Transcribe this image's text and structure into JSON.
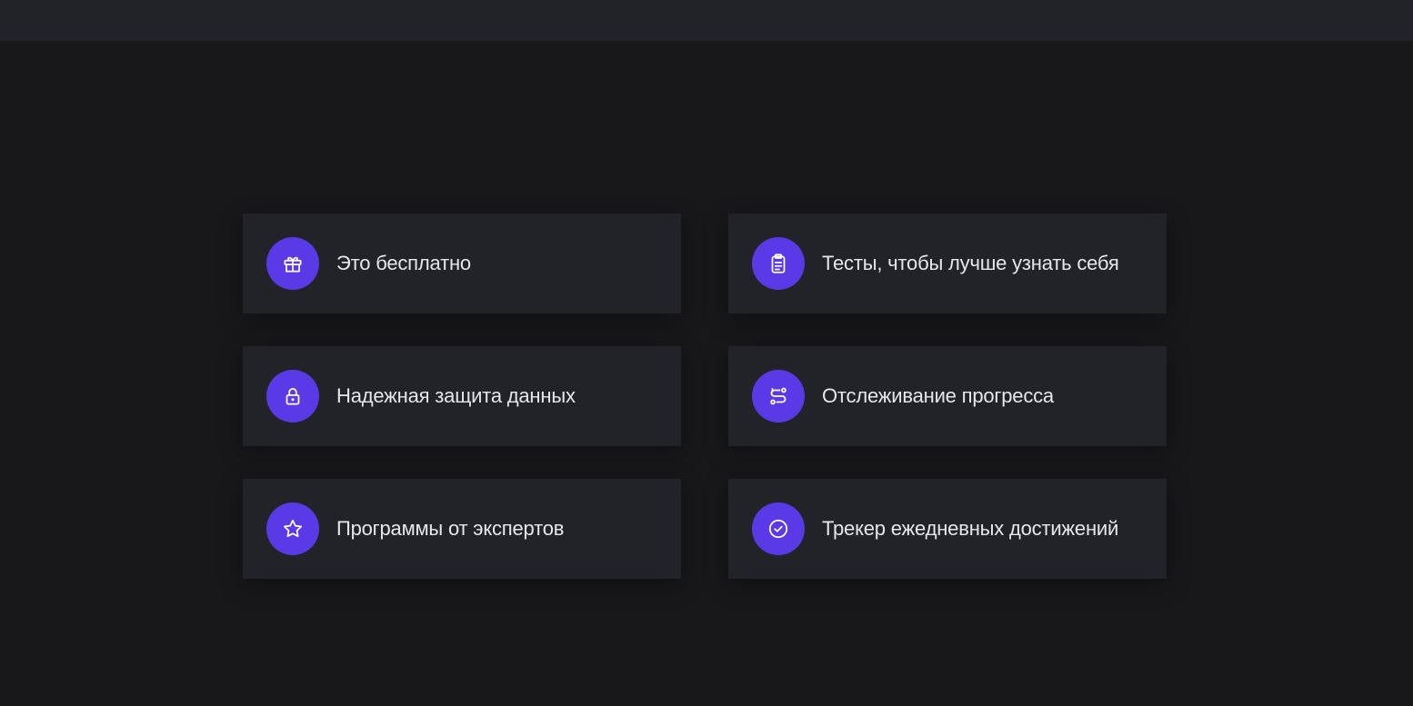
{
  "colors": {
    "background": "#18181a",
    "card": "#222328",
    "accent": "#5a3ae6",
    "text": "#e6e6ee"
  },
  "features": [
    {
      "label": "Это бесплатно",
      "icon": "gift-icon"
    },
    {
      "label": "Тесты, чтобы лучше узнать себя",
      "icon": "clipboard-icon"
    },
    {
      "label": "Надежная защита данных",
      "icon": "lock-icon"
    },
    {
      "label": "Отслеживание прогресса",
      "icon": "route-icon"
    },
    {
      "label": "Программы от экспертов",
      "icon": "star-icon"
    },
    {
      "label": "Трекер ежедневных достижений",
      "icon": "check-circle-icon"
    }
  ]
}
